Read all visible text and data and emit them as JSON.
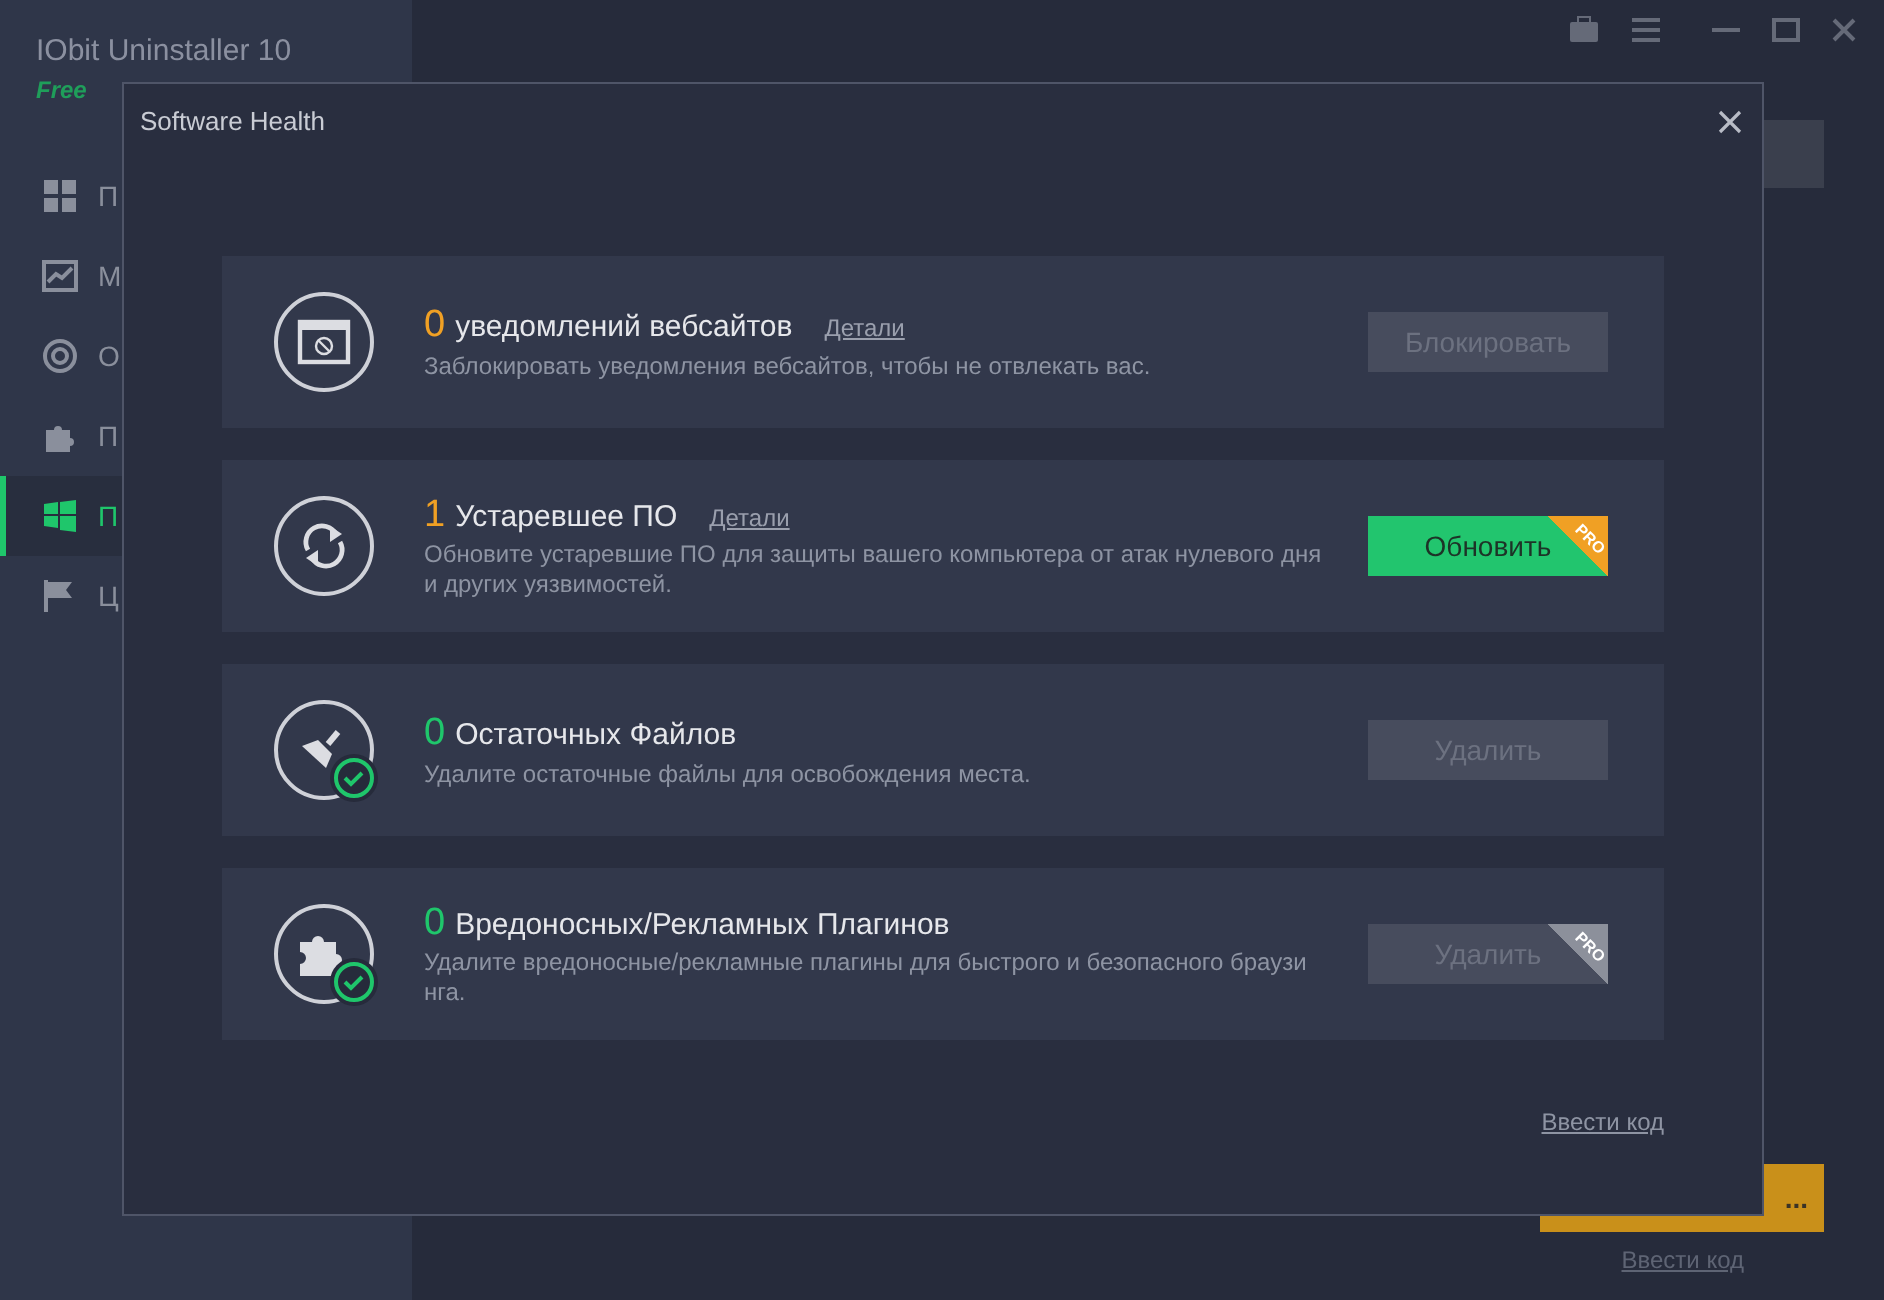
{
  "app": {
    "title": "IObit Uninstaller 10",
    "edition": "Free",
    "sidebar": [
      {
        "label": "П",
        "selected": false
      },
      {
        "label": "М",
        "selected": false
      },
      {
        "label": "О",
        "selected": false
      },
      {
        "label": "П",
        "selected": false
      },
      {
        "label": "П",
        "selected": true
      },
      {
        "label": "Ц",
        "selected": false
      }
    ],
    "action_button": "...",
    "link": "Ввести код"
  },
  "dialog": {
    "title": "Software Health",
    "items": [
      {
        "resolved": false,
        "count": "0",
        "title": "уведомлений вебсайтов",
        "details": "Детали",
        "description": [
          "Заблокировать уведомления вебсайтов, чтобы не отвлекать вас."
        ],
        "button": {
          "label": "Блокировать",
          "disabled": true,
          "pro": false
        }
      },
      {
        "resolved": false,
        "count": "1",
        "title": "Устаревшее ПО",
        "details": "Детали",
        "description": [
          "Обновите устаревшие ПО для защиты вашего компьютера от атак нулевого дня",
          "и других уязвимостей."
        ],
        "button": {
          "label": "Обновить",
          "disabled": false,
          "pro": true,
          "badge": "PRO"
        }
      },
      {
        "resolved": true,
        "count": "0",
        "title": "Остаточных Файлов",
        "description": [
          "Удалите остаточные файлы для освобождения места."
        ],
        "button": {
          "label": "Удалить",
          "disabled": true,
          "pro": false
        }
      },
      {
        "resolved": true,
        "count": "0",
        "title": "Вредоносных/Рекламных Плагинов",
        "description": [
          "Удалите вредоносные/рекламные плагины для быстрого и безопасного браузи",
          "нга."
        ],
        "button": {
          "label": "Удалить",
          "disabled": true,
          "pro": true,
          "badge": "PRO"
        }
      }
    ],
    "link": "Ввести код"
  }
}
